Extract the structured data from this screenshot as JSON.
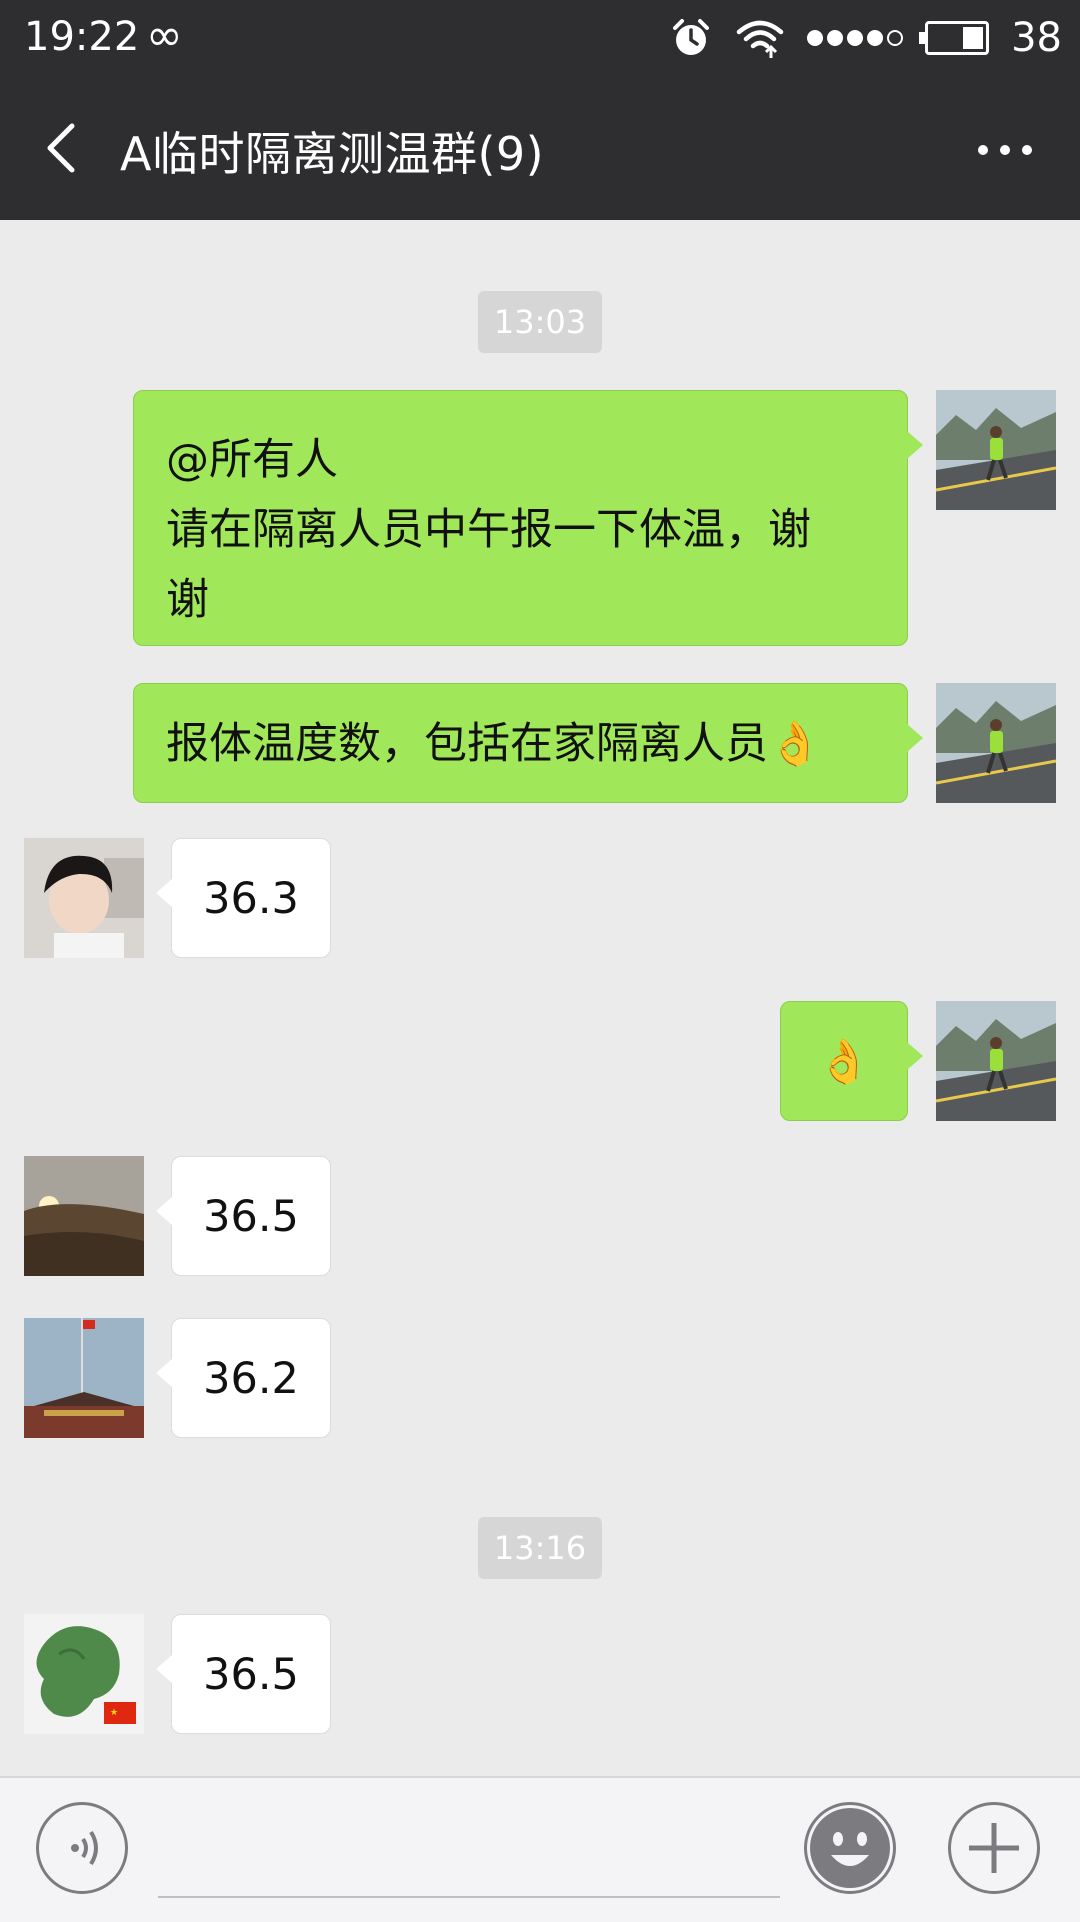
{
  "status_bar": {
    "time": "19:22",
    "infinity": "∞",
    "battery_level": "38"
  },
  "header": {
    "title": "A临时隔离测温群(9)"
  },
  "messages": [
    {
      "type": "time",
      "text": "13:03"
    },
    {
      "type": "me",
      "text": "@所有人\n请在隔离人员中午报一下体温，谢\n谢",
      "avatar": "runner-avatar"
    },
    {
      "type": "me",
      "text": "报体温度数，包括在家隔离人员👌",
      "avatar": "runner-avatar"
    },
    {
      "type": "other",
      "text": "36.3",
      "avatar": "girl-avatar"
    },
    {
      "type": "me",
      "text": "👌",
      "avatar": "runner-avatar"
    },
    {
      "type": "other",
      "text": "36.5",
      "avatar": "sunset-avatar"
    },
    {
      "type": "other",
      "text": "36.2",
      "avatar": "tiananmen-avatar"
    },
    {
      "type": "time",
      "text": "13:16"
    },
    {
      "type": "other",
      "text": "36.5",
      "avatar": "map-flag-avatar"
    }
  ],
  "colors": {
    "header_bg": "#2e2e30",
    "chat_bg": "#ebebeb",
    "my_bubble": "#a0e75a",
    "other_bubble": "#ffffff",
    "timestamp_bg": "#d6d6d6"
  },
  "input_bar": {
    "voice_icon": "voice-icon",
    "emoji_icon": "emoji-icon",
    "plus_icon": "plus-icon"
  }
}
